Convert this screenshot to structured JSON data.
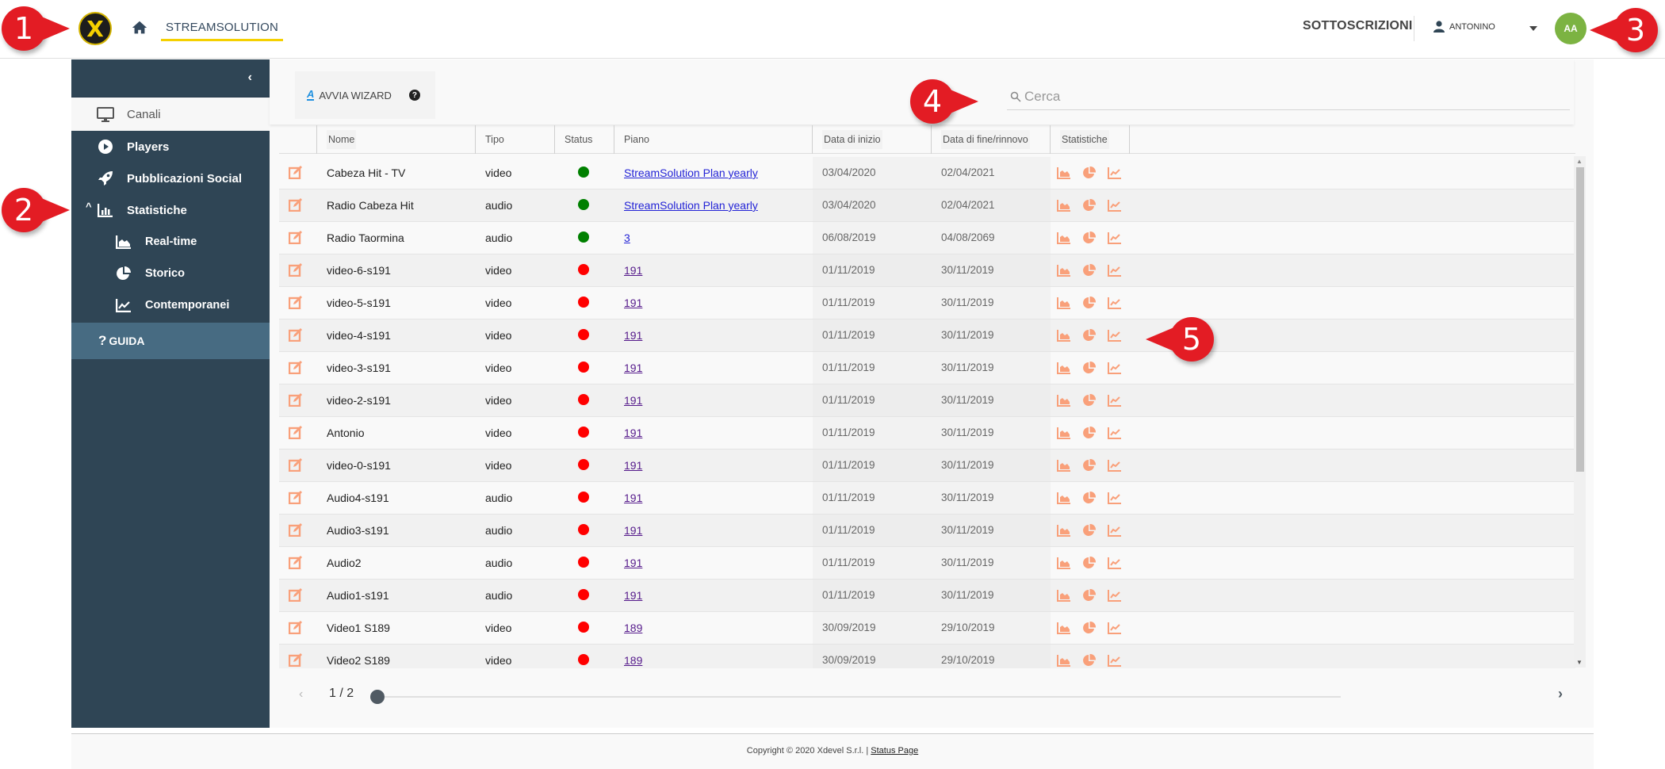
{
  "header": {
    "logo_letter": "X",
    "nav_tab": "STREAMSOLUTION",
    "subscriptions": "SOTTOSCRIZIONI",
    "username": "ANTONINO",
    "avatar_initials": "AA",
    "avatar_color": "#7cb342",
    "accent_color": "#f5d000"
  },
  "sidebar": {
    "collapse_glyph": "‹",
    "items": [
      {
        "label": "Canali",
        "icon": "monitor-icon",
        "active": true
      },
      {
        "label": "Players",
        "icon": "play-circle-icon"
      },
      {
        "label": "Pubblicazioni Social",
        "icon": "rocket-icon"
      },
      {
        "label": "Statistiche",
        "icon": "bar-chart-icon",
        "expanded": true
      },
      {
        "label": "Real-time",
        "icon": "area-chart-icon",
        "sub": true
      },
      {
        "label": "Storico",
        "icon": "pie-chart-icon",
        "sub": true
      },
      {
        "label": "Contemporanei",
        "icon": "line-chart-icon",
        "sub": true
      }
    ],
    "guida": "GUIDA",
    "bg_color": "#2f4555"
  },
  "toolbar": {
    "wizard_label": "AVVIA WIZARD",
    "search_placeholder": "Cerca"
  },
  "table": {
    "columns": [
      "",
      "Nome",
      "Tipo",
      "Status",
      "Piano",
      "Data di inizio",
      "Data di fine/rinnovo",
      "Statistiche"
    ],
    "rows": [
      {
        "nome": "Cabeza Hit - TV",
        "tipo": "video",
        "status": "active",
        "piano": "StreamSolution Plan yearly",
        "inizio": "03/04/2020",
        "fine": "02/04/2021"
      },
      {
        "nome": "Radio Cabeza Hit",
        "tipo": "audio",
        "status": "active",
        "piano": "StreamSolution Plan yearly",
        "inizio": "03/04/2020",
        "fine": "02/04/2021"
      },
      {
        "nome": "Radio Taormina",
        "tipo": "audio",
        "status": "active",
        "piano": "3",
        "inizio": "06/08/2019",
        "fine": "04/08/2069"
      },
      {
        "nome": "video-6-s191",
        "tipo": "video",
        "status": "inactive",
        "piano": "191",
        "inizio": "01/11/2019",
        "fine": "30/11/2019"
      },
      {
        "nome": "video-5-s191",
        "tipo": "video",
        "status": "inactive",
        "piano": "191",
        "inizio": "01/11/2019",
        "fine": "30/11/2019"
      },
      {
        "nome": "video-4-s191",
        "tipo": "video",
        "status": "inactive",
        "piano": "191",
        "inizio": "01/11/2019",
        "fine": "30/11/2019"
      },
      {
        "nome": "video-3-s191",
        "tipo": "video",
        "status": "inactive",
        "piano": "191",
        "inizio": "01/11/2019",
        "fine": "30/11/2019"
      },
      {
        "nome": "video-2-s191",
        "tipo": "video",
        "status": "inactive",
        "piano": "191",
        "inizio": "01/11/2019",
        "fine": "30/11/2019"
      },
      {
        "nome": "Antonio",
        "tipo": "video",
        "status": "inactive",
        "piano": "191",
        "inizio": "01/11/2019",
        "fine": "30/11/2019"
      },
      {
        "nome": "video-0-s191",
        "tipo": "video",
        "status": "inactive",
        "piano": "191",
        "inizio": "01/11/2019",
        "fine": "30/11/2019"
      },
      {
        "nome": "Audio4-s191",
        "tipo": "audio",
        "status": "inactive",
        "piano": "191",
        "inizio": "01/11/2019",
        "fine": "30/11/2019"
      },
      {
        "nome": "Audio3-s191",
        "tipo": "audio",
        "status": "inactive",
        "piano": "191",
        "inizio": "01/11/2019",
        "fine": "30/11/2019"
      },
      {
        "nome": "Audio2",
        "tipo": "audio",
        "status": "inactive",
        "piano": "191",
        "inizio": "01/11/2019",
        "fine": "30/11/2019"
      },
      {
        "nome": "Audio1-s191",
        "tipo": "audio",
        "status": "inactive",
        "piano": "191",
        "inizio": "01/11/2019",
        "fine": "30/11/2019"
      },
      {
        "nome": "Video1 S189",
        "tipo": "video",
        "status": "inactive",
        "piano": "189",
        "inizio": "30/09/2019",
        "fine": "29/10/2019"
      },
      {
        "nome": "Video2 S189",
        "tipo": "video",
        "status": "inactive",
        "piano": "189",
        "inizio": "30/09/2019",
        "fine": "29/10/2019"
      }
    ],
    "status_colors": {
      "active": "#008000",
      "inactive": "#ff0000"
    },
    "icon_color": "#f9a07a"
  },
  "pager": {
    "label": "1 / 2",
    "current": 1,
    "total": 2
  },
  "footer": {
    "copyright": "Copyright © 2020 Xdevel S.r.l. | ",
    "status_link": "Status Page"
  },
  "callouts": [
    "1",
    "2",
    "3",
    "4",
    "5"
  ]
}
